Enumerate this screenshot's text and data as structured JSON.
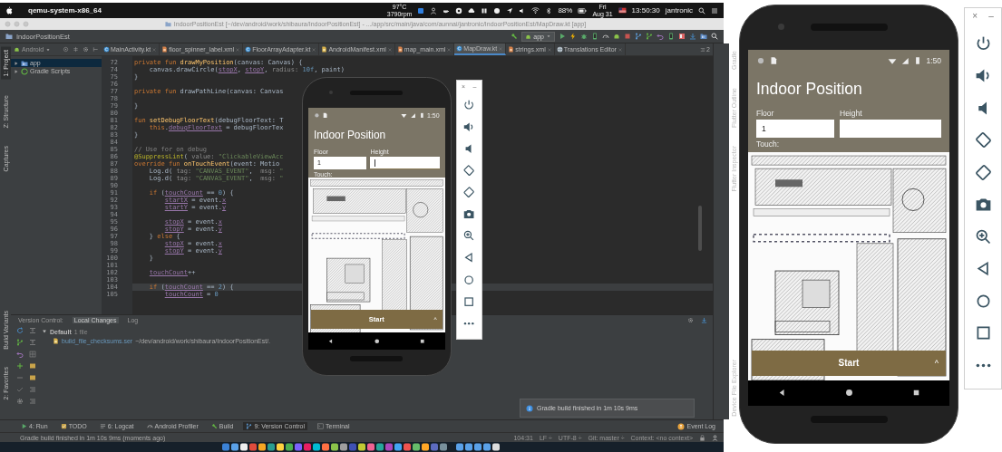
{
  "menubar": {
    "app": "qemu-system-x86_64",
    "temperature": "97°C",
    "fan": "3790rpm",
    "battery": "88%",
    "day": "Fri",
    "date": "Aug 31",
    "time": "13:50:30",
    "user": "jantronic"
  },
  "window": {
    "title": "IndoorPositionEst [~/dev/android/work/shibaura/IndoorPositionEst] - .../app/src/main/java/com/aunnai/jantronic/IndoorPositionEst/MapDraw.kt [app]"
  },
  "navbar": {
    "project": "IndoorPositionEst",
    "run_config": "app"
  },
  "left_strip": {
    "top": [
      {
        "label": "1: Project",
        "selected": true
      },
      {
        "label": "Z: Structure",
        "selected": false
      },
      {
        "label": "Captures",
        "selected": false
      }
    ],
    "bottom": [
      {
        "label": "Build Variants",
        "selected": false
      },
      {
        "label": "2: Favorites",
        "selected": false
      }
    ]
  },
  "right_strip": {
    "top": [
      {
        "label": "Gradle",
        "selected": false
      },
      {
        "label": "Flutter Outline",
        "selected": false
      },
      {
        "label": "Flutter Inspector",
        "selected": false
      }
    ],
    "bottom": [
      {
        "label": "Device File Explorer",
        "selected": false
      }
    ]
  },
  "project_panel": {
    "view": "Android",
    "tree": [
      {
        "label": "app",
        "kind": "module",
        "expanded": false
      },
      {
        "label": "Gradle Scripts",
        "kind": "scripts",
        "expanded": false
      }
    ]
  },
  "tabs": [
    {
      "label": "MainActivity.kt",
      "kind": "kotlin",
      "selected": false
    },
    {
      "label": "floor_spinner_label.xml",
      "kind": "layout",
      "selected": false
    },
    {
      "label": "FloorArrayAdapter.kt",
      "kind": "kotlin",
      "selected": false
    },
    {
      "label": "AndroidManifest.xml",
      "kind": "manifest",
      "selected": false
    },
    {
      "label": "map_main.xml",
      "kind": "layout",
      "selected": false
    },
    {
      "label": "MapDraw.kt",
      "kind": "kotlin",
      "selected": true
    },
    {
      "label": "strings.xml",
      "kind": "values",
      "selected": false
    },
    {
      "label": "Translations Editor",
      "kind": "globe",
      "selected": false
    }
  ],
  "tabs_overflow": "2",
  "editor": {
    "lines": [
      {
        "n": "72",
        "current": false,
        "segs": [
          {
            "kind": "k",
            "text": "private fun "
          },
          {
            "kind": "f",
            "text": "drawMyPosition"
          },
          {
            "kind": "p",
            "text": "(canvas: Canvas) {"
          }
        ]
      },
      {
        "n": "74",
        "current": false,
        "segs": [
          {
            "kind": "p",
            "text": "    canvas.drawCircle("
          },
          {
            "kind": "v",
            "text": "stopX"
          },
          {
            "kind": "p",
            "text": ", "
          },
          {
            "kind": "v",
            "text": "stopY"
          },
          {
            "kind": "p",
            "text": ", "
          },
          {
            "kind": "h",
            "text": "radius: "
          },
          {
            "kind": "n",
            "text": "10f"
          },
          {
            "kind": "p",
            "text": ", paint)"
          }
        ]
      },
      {
        "n": "75",
        "current": false,
        "segs": [
          {
            "kind": "p",
            "text": "}"
          }
        ]
      },
      {
        "n": "76",
        "current": false
      },
      {
        "n": "77",
        "current": false,
        "segs": [
          {
            "kind": "k",
            "text": "private fun "
          },
          {
            "kind": "p",
            "text": "drawPathLine(canvas: Canvas"
          }
        ]
      },
      {
        "n": "78",
        "current": false
      },
      {
        "n": "79",
        "current": false,
        "segs": [
          {
            "kind": "p",
            "text": "}"
          }
        ]
      },
      {
        "n": "80",
        "current": false
      },
      {
        "n": "81",
        "current": false,
        "segs": [
          {
            "kind": "k",
            "text": "fun "
          },
          {
            "kind": "f",
            "text": "setDebugFloorText"
          },
          {
            "kind": "p",
            "text": "(debugFloorText: T"
          }
        ]
      },
      {
        "n": "82",
        "current": false,
        "segs": [
          {
            "kind": "k",
            "text": "    this"
          },
          {
            "kind": "p",
            "text": "."
          },
          {
            "kind": "v",
            "text": "debugFloorText"
          },
          {
            "kind": "p",
            "text": " = debugFloorTex"
          }
        ]
      },
      {
        "n": "83",
        "current": false,
        "segs": [
          {
            "kind": "p",
            "text": "}"
          }
        ]
      },
      {
        "n": "84",
        "current": false
      },
      {
        "n": "85",
        "current": false,
        "segs": [
          {
            "kind": "c",
            "text": "// Use for on debug"
          }
        ]
      },
      {
        "n": "86",
        "current": false,
        "segs": [
          {
            "kind": "a",
            "text": "@SuppressLint"
          },
          {
            "kind": "p",
            "text": "( "
          },
          {
            "kind": "h",
            "text": "value: "
          },
          {
            "kind": "s",
            "text": "\"ClickableViewAcc"
          }
        ]
      },
      {
        "n": "87",
        "current": false,
        "segs": [
          {
            "kind": "k",
            "text": "override fun "
          },
          {
            "kind": "f",
            "text": "onTouchEvent"
          },
          {
            "kind": "p",
            "text": "(event: Motio"
          }
        ]
      },
      {
        "n": "88",
        "current": false,
        "segs": [
          {
            "kind": "p",
            "text": "    Log.d( "
          },
          {
            "kind": "h",
            "text": "tag: "
          },
          {
            "kind": "s",
            "text": "\"CANVAS_EVENT\""
          },
          {
            "kind": "p",
            "text": ",  "
          },
          {
            "kind": "h",
            "text": "msg: "
          },
          {
            "kind": "s",
            "text": "\""
          }
        ]
      },
      {
        "n": "89",
        "current": false,
        "segs": [
          {
            "kind": "p",
            "text": "    Log.d( "
          },
          {
            "kind": "h",
            "text": "tag: "
          },
          {
            "kind": "s",
            "text": "\"CANVAS_EVENT\""
          },
          {
            "kind": "p",
            "text": ",  "
          },
          {
            "kind": "h",
            "text": "msg: "
          },
          {
            "kind": "s",
            "text": "\""
          }
        ]
      },
      {
        "n": "90",
        "current": false
      },
      {
        "n": "91",
        "current": false,
        "segs": [
          {
            "kind": "k",
            "text": "    if "
          },
          {
            "kind": "p",
            "text": "("
          },
          {
            "kind": "v",
            "text": "touchCount"
          },
          {
            "kind": "p",
            "text": " == "
          },
          {
            "kind": "n",
            "text": "0"
          },
          {
            "kind": "p",
            "text": ") {"
          }
        ]
      },
      {
        "n": "92",
        "current": false,
        "segs": [
          {
            "kind": "v",
            "text": "        startX"
          },
          {
            "kind": "p",
            "text": " = event."
          },
          {
            "kind": "v",
            "text": "x"
          }
        ]
      },
      {
        "n": "93",
        "current": false,
        "segs": [
          {
            "kind": "v",
            "text": "        startY"
          },
          {
            "kind": "p",
            "text": " = event."
          },
          {
            "kind": "v",
            "text": "y"
          }
        ]
      },
      {
        "n": "94",
        "current": false
      },
      {
        "n": "95",
        "current": false,
        "segs": [
          {
            "kind": "v",
            "text": "        stopX"
          },
          {
            "kind": "p",
            "text": " = event."
          },
          {
            "kind": "v",
            "text": "x"
          }
        ]
      },
      {
        "n": "96",
        "current": false,
        "segs": [
          {
            "kind": "v",
            "text": "        stopY"
          },
          {
            "kind": "p",
            "text": " = event."
          },
          {
            "kind": "v",
            "text": "y"
          }
        ]
      },
      {
        "n": "97",
        "current": false,
        "segs": [
          {
            "kind": "p",
            "text": "    } "
          },
          {
            "kind": "k",
            "text": "else "
          },
          {
            "kind": "p",
            "text": "{"
          }
        ]
      },
      {
        "n": "98",
        "current": false,
        "segs": [
          {
            "kind": "v",
            "text": "        stopX"
          },
          {
            "kind": "p",
            "text": " = event."
          },
          {
            "kind": "v",
            "text": "x"
          }
        ]
      },
      {
        "n": "99",
        "current": false,
        "segs": [
          {
            "kind": "v",
            "text": "        stopY"
          },
          {
            "kind": "p",
            "text": " = event."
          },
          {
            "kind": "v",
            "text": "y"
          }
        ]
      },
      {
        "n": "100",
        "current": false,
        "segs": [
          {
            "kind": "p",
            "text": "    }"
          }
        ]
      },
      {
        "n": "101",
        "current": false
      },
      {
        "n": "102",
        "current": false,
        "segs": [
          {
            "kind": "v",
            "text": "    touchCount"
          },
          {
            "kind": "p",
            "text": "++"
          }
        ]
      },
      {
        "n": "103",
        "current": false
      },
      {
        "n": "104",
        "current": true,
        "segs": [
          {
            "kind": "k",
            "text": "    if "
          },
          {
            "kind": "p",
            "text": "("
          },
          {
            "kind": "v",
            "text": "touchCount"
          },
          {
            "kind": "p",
            "text": " == "
          },
          {
            "kind": "n",
            "text": "2"
          },
          {
            "kind": "p",
            "text": ") {"
          }
        ]
      },
      {
        "n": "105",
        "current": false,
        "segs": [
          {
            "kind": "v",
            "text": "        touchCount"
          },
          {
            "kind": "p",
            "text": " = "
          },
          {
            "kind": "n",
            "text": "0"
          }
        ]
      }
    ]
  },
  "version_control": {
    "tabs": [
      {
        "label": "Version Control:",
        "selected": false
      },
      {
        "label": "Local Changes",
        "selected": true
      },
      {
        "label": "Log",
        "selected": false
      }
    ],
    "tree": [
      {
        "label": "Default",
        "count": "1 file",
        "expanded": true,
        "children": [
          {
            "label": "build_file_checksums.ser",
            "path": "~/dev/android/work/shibaura/IndoorPositionEst/."
          }
        ]
      }
    ]
  },
  "notification": {
    "text": "Gradle build finished in 1m 10s 9ms"
  },
  "tool_windows": {
    "items": [
      {
        "label": "4: Run",
        "kind": "run",
        "selected": false
      },
      {
        "label": "TODO",
        "kind": "todo",
        "selected": false
      },
      {
        "label": "6: Logcat",
        "kind": "logcat",
        "selected": false
      },
      {
        "label": "Android Profiler",
        "kind": "profiler",
        "selected": false
      },
      {
        "label": "Build",
        "kind": "build",
        "selected": false
      },
      {
        "label": "9: Version Control",
        "kind": "vcs",
        "selected": true
      },
      {
        "label": "Terminal",
        "kind": "terminal",
        "selected": false
      }
    ],
    "event_log": "Event Log"
  },
  "status_bar": {
    "message": "Gradle build finished in 1m 10s 9ms (moments ago)",
    "items": [
      "104:31",
      "LF ÷",
      "UTF-8 ÷",
      "Git: master ÷",
      "Context: <no context>"
    ]
  },
  "emulators": [
    {
      "phone": {
        "time": "1:50",
        "title": "Indoor Position",
        "fields": [
          {
            "label": "Floor",
            "value": "1",
            "focused": false
          },
          {
            "label": "Height",
            "focused": true
          }
        ],
        "touch_label": "Touch:",
        "button": {
          "label": "Start",
          "caret": "^"
        }
      },
      "toolbar": {
        "close": "×",
        "minimize": "–"
      }
    },
    {
      "phone": {
        "time": "1:50",
        "title": "Indoor Position",
        "fields": [
          {
            "label": "Floor",
            "value": "1",
            "focused": false
          },
          {
            "label": "Height",
            "focused": false
          }
        ],
        "touch_label": "Touch:",
        "button": {
          "label": "Start",
          "caret": "^"
        }
      },
      "toolbar": {
        "close": "×",
        "minimize": "–"
      }
    }
  ]
}
